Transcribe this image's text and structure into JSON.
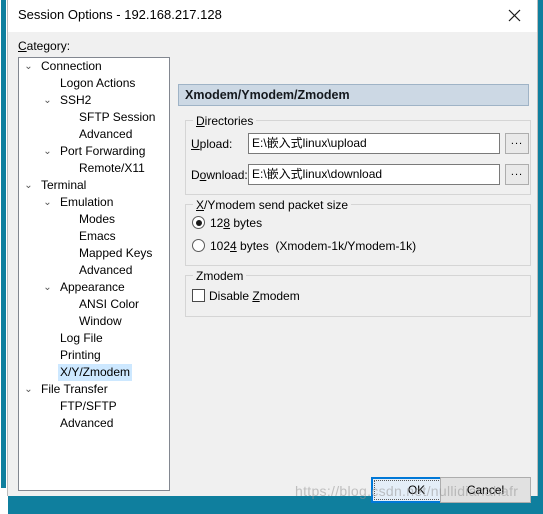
{
  "window": {
    "title": "Session Options - 192.168.217.128",
    "close_icon": "close-icon"
  },
  "sidebar": {
    "label": "Category:",
    "label_accel": "C",
    "items": [
      {
        "label": "Connection",
        "indent": 0,
        "expander": "⌄",
        "selected": false
      },
      {
        "label": "Logon Actions",
        "indent": 1,
        "expander": "",
        "selected": false
      },
      {
        "label": "SSH2",
        "indent": 1,
        "expander": "⌄",
        "selected": false
      },
      {
        "label": "SFTP Session",
        "indent": 2,
        "expander": "",
        "selected": false
      },
      {
        "label": "Advanced",
        "indent": 2,
        "expander": "",
        "selected": false
      },
      {
        "label": "Port Forwarding",
        "indent": 1,
        "expander": "⌄",
        "selected": false
      },
      {
        "label": "Remote/X11",
        "indent": 2,
        "expander": "",
        "selected": false
      },
      {
        "label": "Terminal",
        "indent": 0,
        "expander": "⌄",
        "selected": false
      },
      {
        "label": "Emulation",
        "indent": 1,
        "expander": "⌄",
        "selected": false
      },
      {
        "label": "Modes",
        "indent": 2,
        "expander": "",
        "selected": false
      },
      {
        "label": "Emacs",
        "indent": 2,
        "expander": "",
        "selected": false
      },
      {
        "label": "Mapped Keys",
        "indent": 2,
        "expander": "",
        "selected": false
      },
      {
        "label": "Advanced",
        "indent": 2,
        "expander": "",
        "selected": false
      },
      {
        "label": "Appearance",
        "indent": 1,
        "expander": "⌄",
        "selected": false
      },
      {
        "label": "ANSI Color",
        "indent": 2,
        "expander": "",
        "selected": false
      },
      {
        "label": "Window",
        "indent": 2,
        "expander": "",
        "selected": false
      },
      {
        "label": "Log File",
        "indent": 1,
        "expander": "",
        "selected": false
      },
      {
        "label": "Printing",
        "indent": 1,
        "expander": "",
        "selected": false
      },
      {
        "label": "X/Y/Zmodem",
        "indent": 1,
        "expander": "",
        "selected": true
      },
      {
        "label": "File Transfer",
        "indent": 0,
        "expander": "⌄",
        "selected": false
      },
      {
        "label": "FTP/SFTP",
        "indent": 1,
        "expander": "",
        "selected": false
      },
      {
        "label": "Advanced",
        "indent": 1,
        "expander": "",
        "selected": false
      }
    ]
  },
  "pane": {
    "header": "Xmodem/Ymodem/Zmodem",
    "directories": {
      "legend_pre": "",
      "legend_accel": "D",
      "legend_post": "irectories",
      "upload": {
        "label_accel": "U",
        "label_post": "pload:",
        "value": "E:\\嵌入式linux\\upload",
        "browse_label": "..."
      },
      "download": {
        "label_pre": "D",
        "label_accel": "o",
        "label_post": "wnload:",
        "value": "E:\\嵌入式linux\\download",
        "browse_label": "..."
      }
    },
    "packet_size": {
      "legend_accel": "X",
      "legend_post": "/Ymodem send packet size",
      "options": [
        {
          "pre": "12",
          "accel": "8",
          "post": " bytes",
          "selected": true
        },
        {
          "pre": "102",
          "accel": "4",
          "post": " bytes  (Xmodem-1k/Ymodem-1k)",
          "selected": false
        }
      ]
    },
    "zmodem": {
      "legend": "Zmodem",
      "checkbox": {
        "pre": "Disable ",
        "accel": "Z",
        "post": "modem",
        "checked": false
      }
    }
  },
  "footer": {
    "ok_label": "OK",
    "cancel_label": "Cancel"
  },
  "watermark": {
    "text": "https://blog.csdn.net/nullidianahafr"
  },
  "colors": {
    "desktop_teal": "#0f7f9e",
    "dialog_bg": "#f0f0f0",
    "pane_header_bg": "#ccd8e4",
    "selection_blue": "#cde8ff",
    "focus_blue": "#0078d7"
  }
}
